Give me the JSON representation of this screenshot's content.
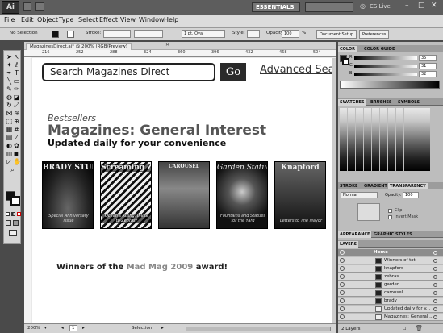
{
  "app": {
    "logo_text": "Ai",
    "workspace": "ESSENTIALS",
    "cs_live": "CS Live"
  },
  "menu": [
    "File",
    "Edit",
    "Object",
    "Type",
    "Select",
    "Effect",
    "View",
    "Window",
    "Help"
  ],
  "control_bar": {
    "selection": "No Selection",
    "stroke_label": "Stroke:",
    "brush": "1 pt. Oval",
    "style_label": "Style:",
    "opacity_label": "Opacity:",
    "opacity_value": "100",
    "opacity_unit": "%",
    "document_setup": "Document Setup",
    "preferences": "Preferences"
  },
  "document": {
    "tab_title": "MagazinesDirect.ai* @ 200% (RGB/Preview)",
    "ruler_marks": [
      "216",
      "252",
      "288",
      "324",
      "360",
      "396",
      "432",
      "468",
      "504"
    ],
    "zoom": "200%",
    "page": "1",
    "status_tool": "Selection"
  },
  "webpage": {
    "search_placeholder": "Search Magazines Direct",
    "go_label": "Go",
    "advanced_search": "Advanced Sear",
    "bestsellers": "Bestsellers",
    "heading": "Magazines: General Interest",
    "subheading": "Updated daily for your convenience",
    "covers": [
      {
        "title": "BRADY STUDIOS",
        "subtitle": "Special Anniversary Issue"
      },
      {
        "title": "Screaming Zebras",
        "subtitle": "Ocean's Rising: Invite to Zebras?"
      },
      {
        "title": "CAROUSEL",
        "subtitle": ""
      },
      {
        "title": "Garden Statues",
        "subtitle": "Fountains and Statues for the Yard"
      },
      {
        "title": "Knapford",
        "subtitle": "Letters to The Mayor"
      }
    ],
    "winners_prefix": "Winners of the ",
    "winners_highlight": "Mad Mag 2009",
    "winners_suffix": " award!"
  },
  "panels": {
    "color_tabs": [
      "COLOR",
      "COLOR GUIDE"
    ],
    "color_rows": [
      {
        "label": "R",
        "value": "35"
      },
      {
        "label": "G",
        "value": "31"
      },
      {
        "label": "B",
        "value": "32"
      }
    ],
    "swatch_tabs": [
      "SWATCHES",
      "BRUSHES",
      "SYMBOLS"
    ],
    "stroke_tabs": [
      "STROKE",
      "GRADIENT",
      "TRANSPARENCY"
    ],
    "blend_mode": "Normal",
    "opacity_label": "Opacity:",
    "opacity_value": "100",
    "clip": "Clip",
    "invert_mask": "Invert Mask",
    "appearance_tabs": [
      "APPEARANCE",
      "GRAPHIC STYLES"
    ],
    "layers_title": "LAYERS",
    "layers": [
      {
        "name": "Home",
        "header": true
      },
      {
        "name": "Winners of txt"
      },
      {
        "name": "knapford"
      },
      {
        "name": "zebras"
      },
      {
        "name": "garden"
      },
      {
        "name": "carousel"
      },
      {
        "name": "brady"
      },
      {
        "name": "Updated daily for y..."
      },
      {
        "name": "Magazines: General ..."
      }
    ],
    "layers_count": "2 Layers"
  }
}
